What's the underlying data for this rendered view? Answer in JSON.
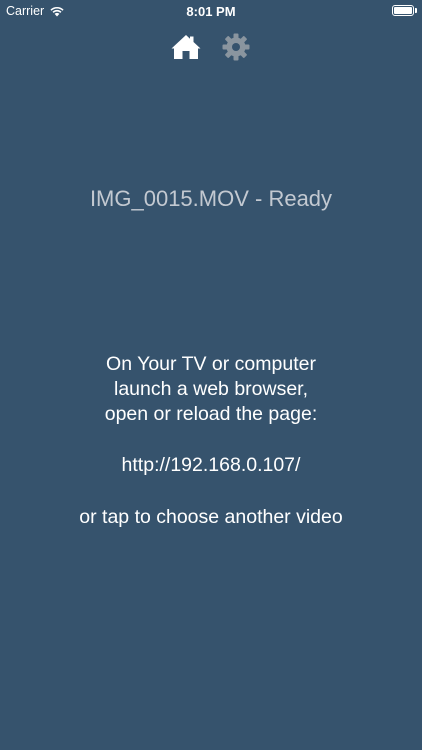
{
  "status_bar": {
    "carrier": "Carrier",
    "time": "8:01 PM",
    "icons": [
      "wifi-icon",
      "battery-icon"
    ]
  },
  "toolbar": {
    "home_icon": "home-icon",
    "settings_icon": "gear-icon"
  },
  "file_status": "IMG_0015.MOV - Ready",
  "instructions": {
    "line1": "On Your TV or computer",
    "line2": "launch a web browser,",
    "line3": "open or reload the page:",
    "url": "http://192.168.0.107/",
    "choose": "or tap to choose another video"
  },
  "colors": {
    "background": "#36536d",
    "icon_active": "#ffffff",
    "icon_inactive": "#8a959f",
    "status_text": "#c3c9d1"
  }
}
